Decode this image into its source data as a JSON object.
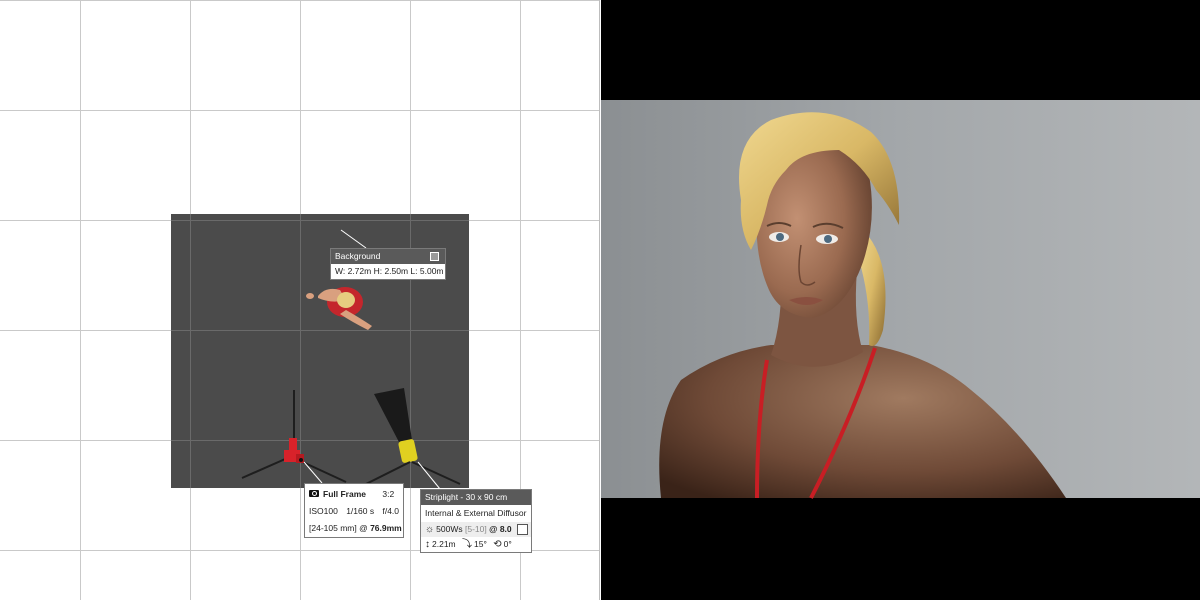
{
  "background_label": {
    "title": "Background",
    "swatch_color": "#9a9a9a",
    "dimensions": "W: 2.72m H: 2.50m L: 5.00m"
  },
  "camera_label": {
    "sensor": "Full Frame",
    "aspect": "3:2",
    "iso": "ISO100",
    "shutter": "1/160 s",
    "aperture": "f/4.0",
    "lens_range": "[24-105 mm] @",
    "focal_length": "76.9mm"
  },
  "striplight_label": {
    "title": "Striplight - 30 x 90 cm",
    "modifier": "Internal & External Diffusor",
    "power": "500Ws",
    "power_range": "[5-10]",
    "power_at": "@",
    "power_setting": "8.0",
    "height": "2.21m",
    "tilt": "15°",
    "rotation": "0°"
  },
  "icons": {
    "camera": "camera-icon",
    "sun": "sun-icon",
    "height": "height-icon",
    "tilt": "tilt-icon",
    "rotation": "rotation-icon"
  },
  "colors": {
    "studio_floor": "#4b4b4b",
    "camera_body": "#d8222a",
    "softbox_head": "#e0d020",
    "label_header": "#5a5a5a",
    "backdrop": "#9ea1a3"
  }
}
